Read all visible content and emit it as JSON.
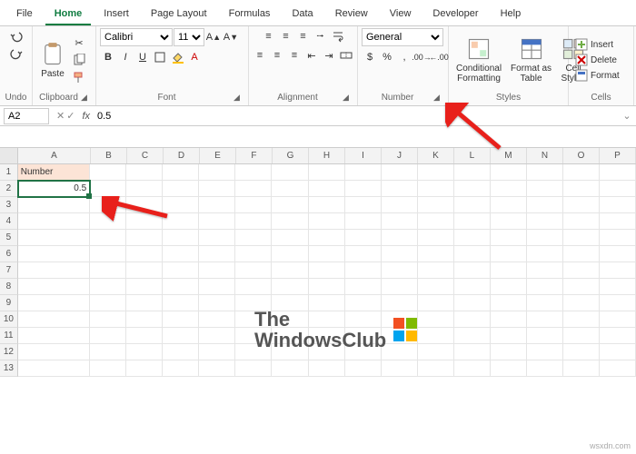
{
  "tabs": [
    "File",
    "Home",
    "Insert",
    "Page Layout",
    "Formulas",
    "Data",
    "Review",
    "View",
    "Developer",
    "Help"
  ],
  "active_tab": "Home",
  "ribbon": {
    "undo_label": "Undo",
    "clipboard": {
      "paste": "Paste",
      "label": "Clipboard"
    },
    "font": {
      "name": "Calibri",
      "size": "11",
      "label": "Font"
    },
    "alignment": {
      "label": "Alignment"
    },
    "number": {
      "format": "General",
      "label": "Number"
    },
    "styles": {
      "cond": "Conditional\nFormatting",
      "table": "Format as\nTable",
      "cell": "Cell\nStyles",
      "label": "Styles"
    },
    "cells": {
      "insert": "Insert",
      "delete": "Delete",
      "format": "Format",
      "label": "Cells"
    }
  },
  "namebox": "A2",
  "formula": "0.5",
  "columns": [
    "A",
    "B",
    "C",
    "D",
    "E",
    "F",
    "G",
    "H",
    "I",
    "J",
    "K",
    "L",
    "M",
    "N",
    "O",
    "P"
  ],
  "rows": [
    "1",
    "2",
    "3",
    "4",
    "5",
    "6",
    "7",
    "8",
    "9",
    "10",
    "11",
    "12",
    "13"
  ],
  "data": {
    "A1": "Number",
    "A2": "0.5"
  },
  "watermark": {
    "line1": "The",
    "line2": "WindowsClub"
  },
  "domain_host": "wsxdn.com"
}
